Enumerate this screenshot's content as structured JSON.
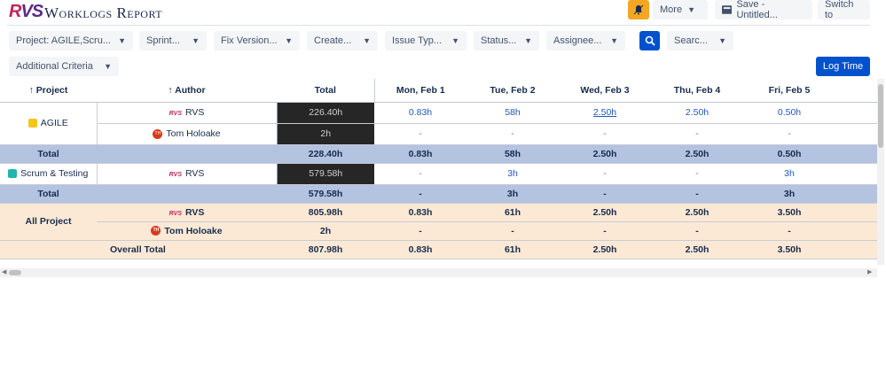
{
  "header": {
    "logo_r": "R",
    "logo_vs": "VS",
    "title": "Worklogs Report",
    "more_label": "More",
    "save_label": "Save - Untitled...",
    "switch_label": "Switch to",
    "bell_color": "#f5a623"
  },
  "filters": [
    {
      "id": "project",
      "label": "Project: AGILE,Scru..."
    },
    {
      "id": "sprint",
      "label": "Sprint..."
    },
    {
      "id": "fix-version",
      "label": "Fix Version..."
    },
    {
      "id": "created",
      "label": "Create..."
    },
    {
      "id": "issue-type",
      "label": "Issue Typ..."
    },
    {
      "id": "status",
      "label": "Status..."
    },
    {
      "id": "assignee",
      "label": "Assignee..."
    },
    {
      "id": "search",
      "label": "Searc..."
    },
    {
      "id": "additional",
      "label": "Additional Criteria"
    }
  ],
  "log_time_label": "Log Time",
  "table": {
    "headers": {
      "project": "↑ Project",
      "author": "↑ Author",
      "total": "Total",
      "days": [
        "Mon, Feb  1",
        "Tue, Feb  2",
        "Wed, Feb 3",
        "Thu, Feb 4",
        "Fri, Feb 5"
      ]
    },
    "agile": {
      "name": "AGILE",
      "rows": [
        {
          "author": "RVS",
          "total": "226.40h",
          "days": [
            "0.83h",
            "58h",
            "2.50h",
            "2.50h",
            "0.50h"
          ]
        },
        {
          "author": "Tom Holoake",
          "avatar": "TH",
          "total": "2h",
          "days": [
            "-",
            "-",
            "-",
            "-",
            "-"
          ]
        }
      ],
      "subtotal": {
        "label": "Total",
        "total": "228.40h",
        "days": [
          "0.83h",
          "58h",
          "2.50h",
          "2.50h",
          "0.50h"
        ]
      }
    },
    "scrum": {
      "name": "Scrum & Testing",
      "rows": [
        {
          "author": "RVS",
          "total": "579.58h",
          "days": [
            "-",
            "3h",
            "-",
            "-",
            "3h"
          ]
        }
      ],
      "subtotal": {
        "label": "Total",
        "total": "579.58h",
        "days": [
          "-",
          "3h",
          "-",
          "-",
          "3h"
        ]
      }
    },
    "all": {
      "name": "All Project",
      "rows": [
        {
          "author": "RVS",
          "total": "805.98h",
          "days": [
            "0.83h",
            "61h",
            "2.50h",
            "2.50h",
            "3.50h"
          ]
        },
        {
          "author": "Tom Holoake",
          "avatar": "TH",
          "total": "2h",
          "days": [
            "-",
            "-",
            "-",
            "-",
            "-"
          ]
        }
      ],
      "overall": {
        "label": "Overall Total",
        "total": "807.98h",
        "days": [
          "0.83h",
          "61h",
          "2.50h",
          "2.50h",
          "3.50h"
        ]
      }
    }
  },
  "colors": {
    "accent": "#0052cc",
    "subtotal_bg": "#b3c3e0",
    "all_bg": "#fbe9d6",
    "total_cell_bg": "#262626"
  }
}
